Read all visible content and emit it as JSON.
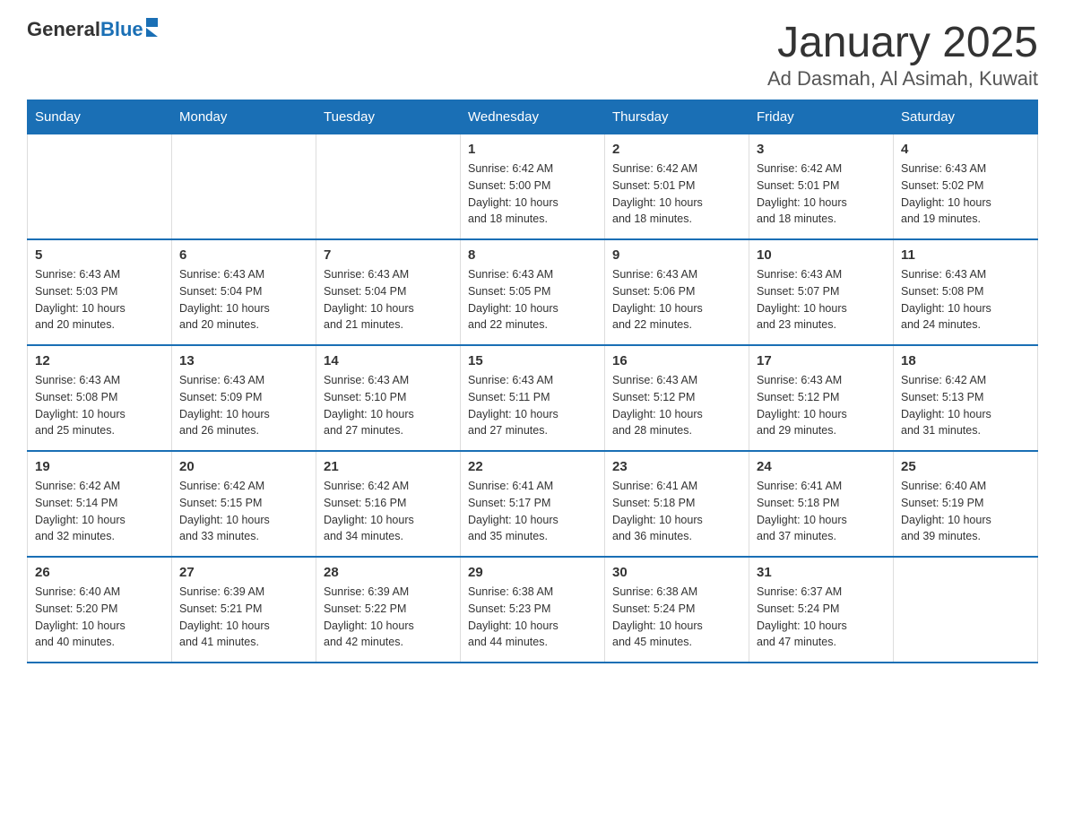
{
  "header": {
    "logo_text_black": "General",
    "logo_text_blue": "Blue",
    "title": "January 2025",
    "subtitle": "Ad Dasmah, Al Asimah, Kuwait"
  },
  "days_of_week": [
    "Sunday",
    "Monday",
    "Tuesday",
    "Wednesday",
    "Thursday",
    "Friday",
    "Saturday"
  ],
  "weeks": [
    [
      {
        "day": "",
        "info": ""
      },
      {
        "day": "",
        "info": ""
      },
      {
        "day": "",
        "info": ""
      },
      {
        "day": "1",
        "info": "Sunrise: 6:42 AM\nSunset: 5:00 PM\nDaylight: 10 hours\nand 18 minutes."
      },
      {
        "day": "2",
        "info": "Sunrise: 6:42 AM\nSunset: 5:01 PM\nDaylight: 10 hours\nand 18 minutes."
      },
      {
        "day": "3",
        "info": "Sunrise: 6:42 AM\nSunset: 5:01 PM\nDaylight: 10 hours\nand 18 minutes."
      },
      {
        "day": "4",
        "info": "Sunrise: 6:43 AM\nSunset: 5:02 PM\nDaylight: 10 hours\nand 19 minutes."
      }
    ],
    [
      {
        "day": "5",
        "info": "Sunrise: 6:43 AM\nSunset: 5:03 PM\nDaylight: 10 hours\nand 20 minutes."
      },
      {
        "day": "6",
        "info": "Sunrise: 6:43 AM\nSunset: 5:04 PM\nDaylight: 10 hours\nand 20 minutes."
      },
      {
        "day": "7",
        "info": "Sunrise: 6:43 AM\nSunset: 5:04 PM\nDaylight: 10 hours\nand 21 minutes."
      },
      {
        "day": "8",
        "info": "Sunrise: 6:43 AM\nSunset: 5:05 PM\nDaylight: 10 hours\nand 22 minutes."
      },
      {
        "day": "9",
        "info": "Sunrise: 6:43 AM\nSunset: 5:06 PM\nDaylight: 10 hours\nand 22 minutes."
      },
      {
        "day": "10",
        "info": "Sunrise: 6:43 AM\nSunset: 5:07 PM\nDaylight: 10 hours\nand 23 minutes."
      },
      {
        "day": "11",
        "info": "Sunrise: 6:43 AM\nSunset: 5:08 PM\nDaylight: 10 hours\nand 24 minutes."
      }
    ],
    [
      {
        "day": "12",
        "info": "Sunrise: 6:43 AM\nSunset: 5:08 PM\nDaylight: 10 hours\nand 25 minutes."
      },
      {
        "day": "13",
        "info": "Sunrise: 6:43 AM\nSunset: 5:09 PM\nDaylight: 10 hours\nand 26 minutes."
      },
      {
        "day": "14",
        "info": "Sunrise: 6:43 AM\nSunset: 5:10 PM\nDaylight: 10 hours\nand 27 minutes."
      },
      {
        "day": "15",
        "info": "Sunrise: 6:43 AM\nSunset: 5:11 PM\nDaylight: 10 hours\nand 27 minutes."
      },
      {
        "day": "16",
        "info": "Sunrise: 6:43 AM\nSunset: 5:12 PM\nDaylight: 10 hours\nand 28 minutes."
      },
      {
        "day": "17",
        "info": "Sunrise: 6:43 AM\nSunset: 5:12 PM\nDaylight: 10 hours\nand 29 minutes."
      },
      {
        "day": "18",
        "info": "Sunrise: 6:42 AM\nSunset: 5:13 PM\nDaylight: 10 hours\nand 31 minutes."
      }
    ],
    [
      {
        "day": "19",
        "info": "Sunrise: 6:42 AM\nSunset: 5:14 PM\nDaylight: 10 hours\nand 32 minutes."
      },
      {
        "day": "20",
        "info": "Sunrise: 6:42 AM\nSunset: 5:15 PM\nDaylight: 10 hours\nand 33 minutes."
      },
      {
        "day": "21",
        "info": "Sunrise: 6:42 AM\nSunset: 5:16 PM\nDaylight: 10 hours\nand 34 minutes."
      },
      {
        "day": "22",
        "info": "Sunrise: 6:41 AM\nSunset: 5:17 PM\nDaylight: 10 hours\nand 35 minutes."
      },
      {
        "day": "23",
        "info": "Sunrise: 6:41 AM\nSunset: 5:18 PM\nDaylight: 10 hours\nand 36 minutes."
      },
      {
        "day": "24",
        "info": "Sunrise: 6:41 AM\nSunset: 5:18 PM\nDaylight: 10 hours\nand 37 minutes."
      },
      {
        "day": "25",
        "info": "Sunrise: 6:40 AM\nSunset: 5:19 PM\nDaylight: 10 hours\nand 39 minutes."
      }
    ],
    [
      {
        "day": "26",
        "info": "Sunrise: 6:40 AM\nSunset: 5:20 PM\nDaylight: 10 hours\nand 40 minutes."
      },
      {
        "day": "27",
        "info": "Sunrise: 6:39 AM\nSunset: 5:21 PM\nDaylight: 10 hours\nand 41 minutes."
      },
      {
        "day": "28",
        "info": "Sunrise: 6:39 AM\nSunset: 5:22 PM\nDaylight: 10 hours\nand 42 minutes."
      },
      {
        "day": "29",
        "info": "Sunrise: 6:38 AM\nSunset: 5:23 PM\nDaylight: 10 hours\nand 44 minutes."
      },
      {
        "day": "30",
        "info": "Sunrise: 6:38 AM\nSunset: 5:24 PM\nDaylight: 10 hours\nand 45 minutes."
      },
      {
        "day": "31",
        "info": "Sunrise: 6:37 AM\nSunset: 5:24 PM\nDaylight: 10 hours\nand 47 minutes."
      },
      {
        "day": "",
        "info": ""
      }
    ]
  ]
}
